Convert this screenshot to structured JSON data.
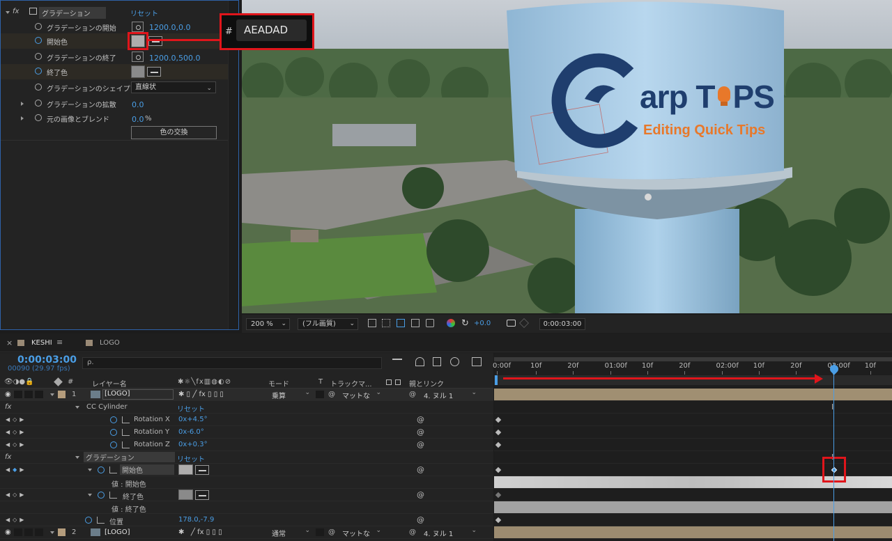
{
  "effects_panel": {
    "header": {
      "fx": "fx",
      "effect_name": "グラデーション",
      "reset": "リセット"
    },
    "rows": [
      {
        "label": "グラデーションの開始",
        "value": "1200.0,0.0"
      },
      {
        "label": "開始色"
      },
      {
        "label": "グラデーションの終了",
        "value": "1200.0,500.0"
      },
      {
        "label": "終了色"
      },
      {
        "label": "グラデーションのシェイプ",
        "dropdown": "直線状"
      },
      {
        "label": "グラデーションの拡散",
        "value": "0.0"
      },
      {
        "label": "元の画像とブレンド",
        "value": "0.0",
        "unit": "%"
      }
    ],
    "swap_button": "色の交換",
    "start_color_hex": "#AEADAD"
  },
  "callout": {
    "hash": "#",
    "hex": "AEADAD"
  },
  "viewer": {
    "logo_text_1": "arp T",
    "logo_text_2": "PS",
    "logo_sub": "Editing Quick Tips",
    "zoom": "200 %",
    "quality": "(フル画質)",
    "exposure": "+0.0",
    "timecode": "0:00:03:00"
  },
  "timeline": {
    "tabs": [
      {
        "label": "KESHI"
      },
      {
        "label": "LOGO"
      }
    ],
    "current_time": "0:00:03:00",
    "frames": "00090 (29.97 fps)",
    "search_placeholder": "ρ.",
    "columns": {
      "layer_name": "レイヤー名",
      "mode": "モード",
      "t": "T",
      "track_matte": "トラックマ...",
      "parent": "親とリンク"
    },
    "ruler": [
      "0:00f",
      "10f",
      "20f",
      "01:00f",
      "10f",
      "20f",
      "02:00f",
      "10f",
      "20f",
      "03:00f",
      "10f"
    ],
    "rows": {
      "layer1": {
        "num": "1",
        "name": "[LOGO]",
        "mode": "乗算",
        "matte": "マットな",
        "parent": "4. ヌル 1"
      },
      "cc_cylinder": {
        "name": "CC Cylinder",
        "reset": "リセット"
      },
      "rot_x": {
        "name": "Rotation X",
        "value": "0x+4.5°"
      },
      "rot_y": {
        "name": "Rotation Y",
        "value": "0x-6.0°"
      },
      "rot_z": {
        "name": "Rotation Z",
        "value": "0x+0.3°"
      },
      "gradient": {
        "name": "グラデーション",
        "reset": "リセット"
      },
      "start_color": {
        "name": "開始色"
      },
      "start_color_value": {
        "name": "値 : 開始色"
      },
      "end_color": {
        "name": "終了色"
      },
      "end_color_value": {
        "name": "値 : 終了色"
      },
      "position": {
        "name": "位置",
        "value": "178.0,-7.9"
      },
      "layer2": {
        "num": "2",
        "name": "[LOGO]",
        "mode": "通常",
        "matte": "マットな",
        "parent": "4. ヌル 1"
      }
    }
  },
  "colors": {
    "accent": "#4a9ee6",
    "highlight": "#e0151b",
    "tower": "#a9cfe8",
    "logo_navy": "#1f3e6e",
    "logo_orange": "#e8782a"
  }
}
